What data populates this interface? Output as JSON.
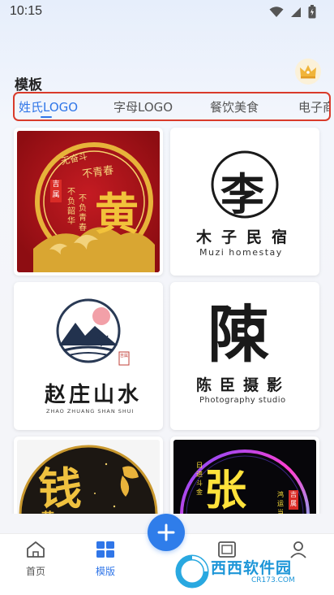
{
  "status_bar": {
    "time": "10:15",
    "icons": [
      "wifi-icon",
      "signal-icon",
      "battery-icon"
    ]
  },
  "section": {
    "title": "模板"
  },
  "tabs": [
    {
      "label": "姓氏LOGO",
      "active": true
    },
    {
      "label": "字母LOGO",
      "active": false
    },
    {
      "label": "餐饮美食",
      "active": false
    },
    {
      "label": "电子商",
      "active": false
    }
  ],
  "templates": [
    {
      "name": "黄",
      "lines": [
        "无奋斗",
        "不青春",
        "不负韶华",
        "不负青春",
        "吉",
        "属"
      ],
      "style": "red-gold"
    },
    {
      "name": "木子民宿",
      "subtitle": "Muzi homestay",
      "mark": "李",
      "style": "black-white"
    },
    {
      "name": "赵庄山水",
      "subtitle": "ZHAO ZHUANG SHAN SHUI",
      "seal": "吉属",
      "style": "ink"
    },
    {
      "name": "陈臣摄影",
      "subtitle": "Photography studio",
      "mark": "陳",
      "style": "black-white"
    },
    {
      "name": "钱",
      "sub": "花",
      "style": "gold-black"
    },
    {
      "name": "张",
      "lines": [
        "日进斗金",
        "鸿运当头",
        "吉",
        "属"
      ],
      "style": "neon"
    }
  ],
  "bottom_nav": [
    {
      "label": "首页",
      "icon": "home-icon",
      "active": false
    },
    {
      "label": "模版",
      "icon": "grid-icon",
      "active": true
    },
    {
      "label": "",
      "icon": "plus-icon",
      "active": false
    },
    {
      "label": "",
      "icon": "image-icon",
      "active": false
    },
    {
      "label": "",
      "icon": "profile-icon",
      "active": false
    }
  ],
  "watermark": {
    "brand": "西西软件园",
    "domain": "CR173.COM"
  },
  "colors": {
    "accent": "#3076e8",
    "highlight_border": "#d93b2b",
    "red_card": "#b3121b",
    "gold": "#f2c23b"
  }
}
